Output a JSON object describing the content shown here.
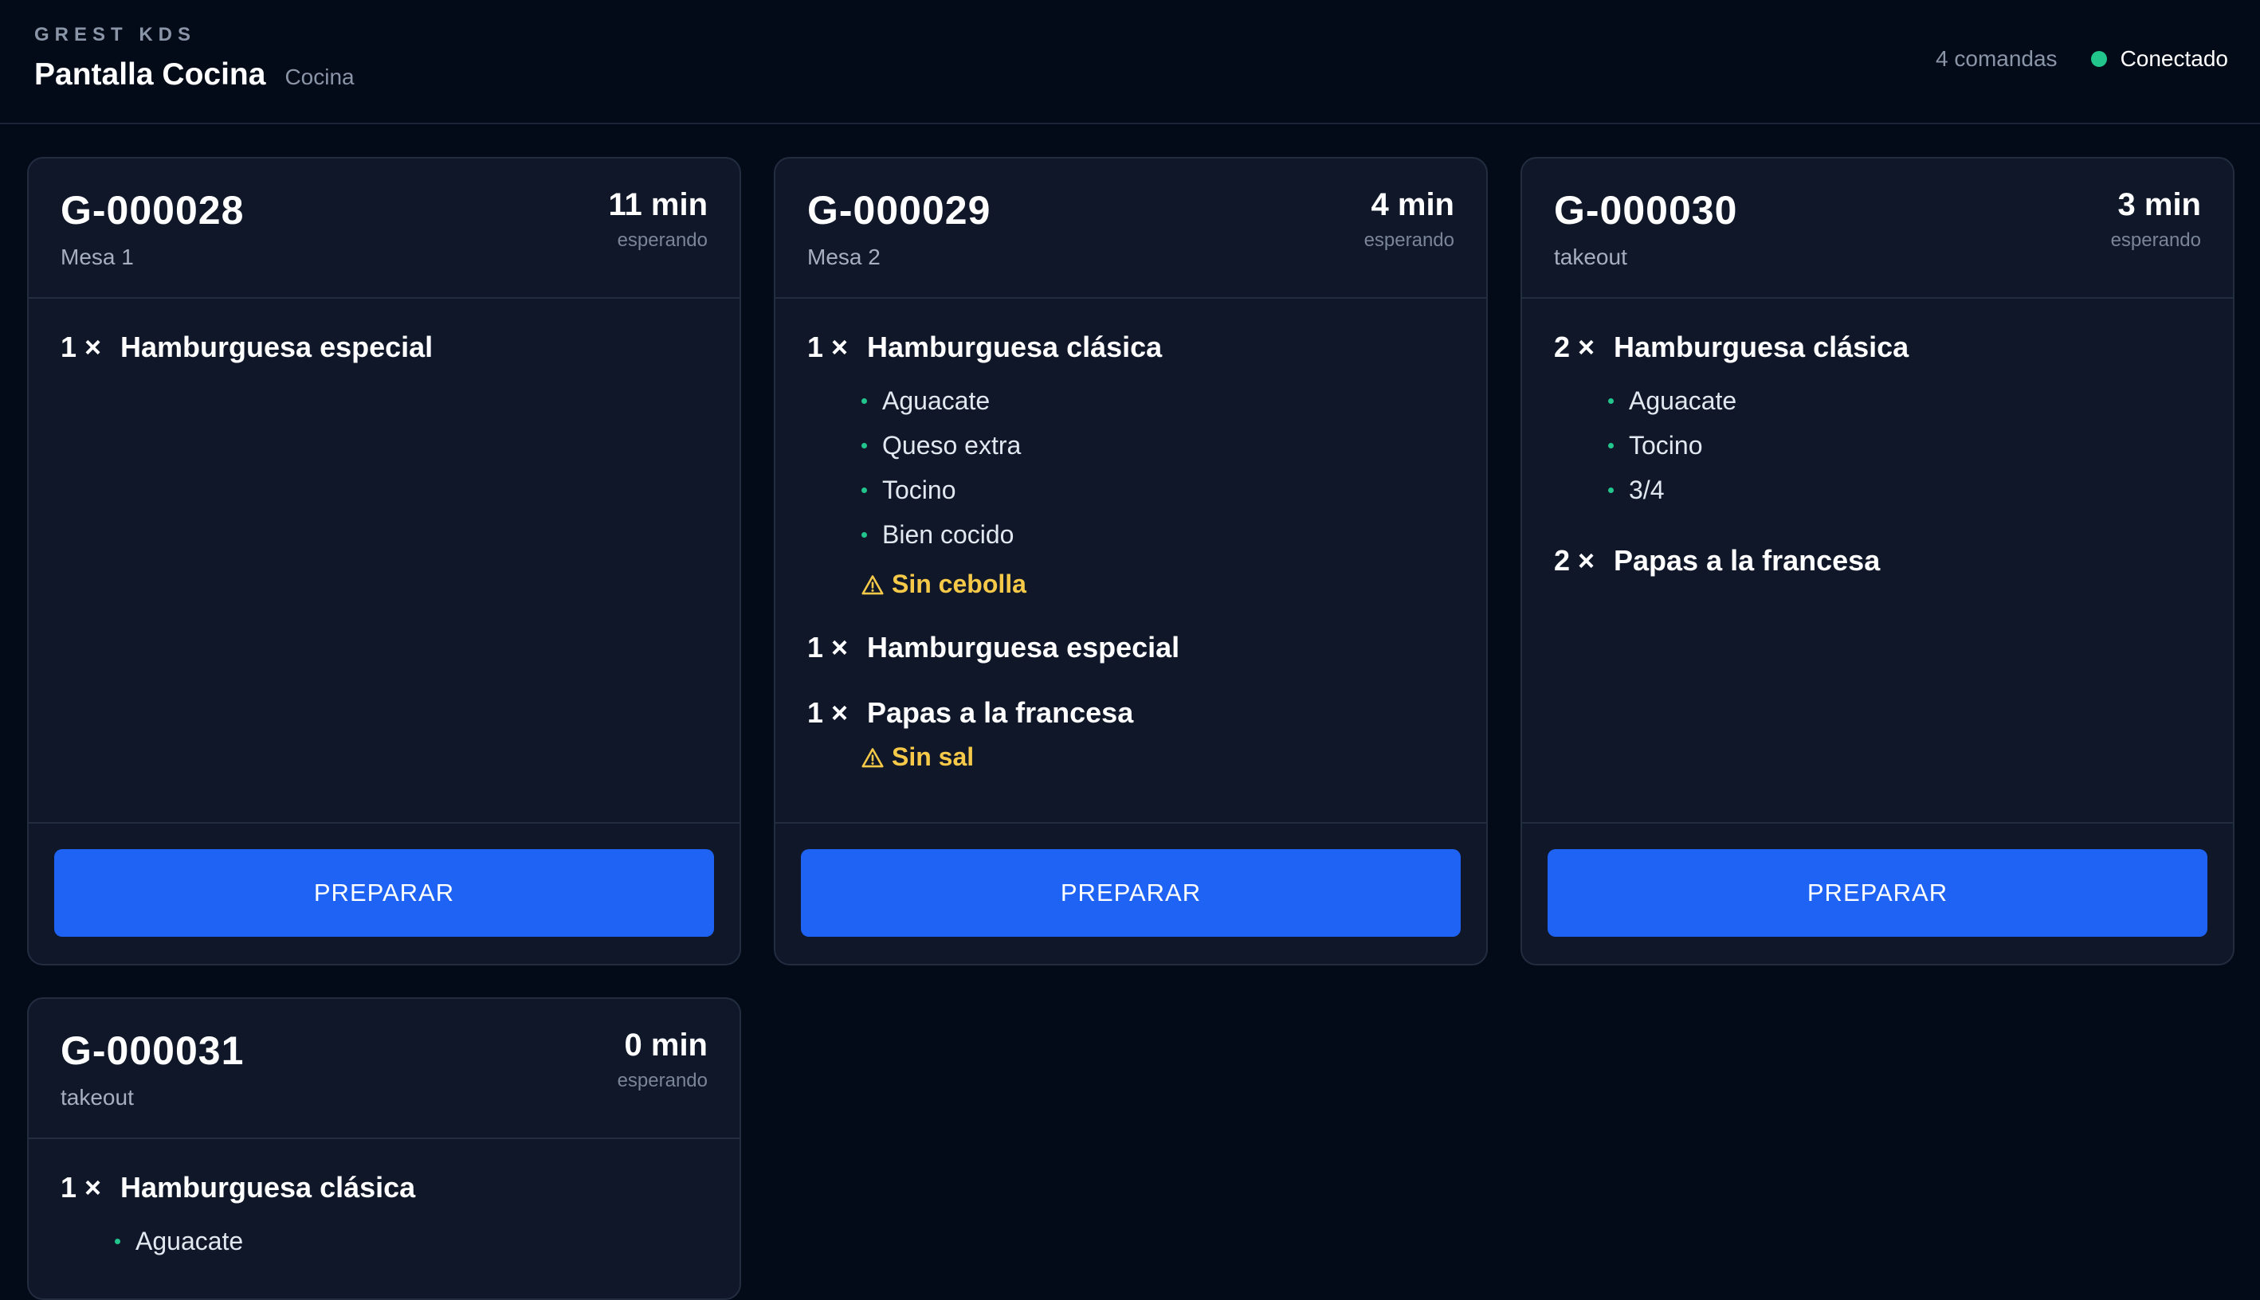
{
  "header": {
    "brand": "GREST KDS",
    "title": "Pantalla Cocina",
    "station": "Cocina",
    "orders_count": "4 comandas",
    "status": "Conectado",
    "status_color": "#22c58b"
  },
  "colors": {
    "background": "#030a18",
    "card": "#0f1729",
    "accent": "#1f63f5",
    "warning": "#f7c948"
  },
  "orders": [
    {
      "id": "G-000028",
      "location": "Mesa 1",
      "wait": "11 min",
      "wait_label": "esperando",
      "button": "PREPARAR",
      "items": [
        {
          "qty": "1 ×",
          "name": "Hamburguesa especial",
          "mods": [],
          "note": ""
        }
      ]
    },
    {
      "id": "G-000029",
      "location": "Mesa 2",
      "wait": "4 min",
      "wait_label": "esperando",
      "button": "PREPARAR",
      "items": [
        {
          "qty": "1 ×",
          "name": "Hamburguesa clásica",
          "mods": [
            "Aguacate",
            "Queso extra",
            "Tocino",
            "Bien cocido"
          ],
          "note": "Sin cebolla"
        },
        {
          "qty": "1 ×",
          "name": "Hamburguesa especial",
          "mods": [],
          "note": ""
        },
        {
          "qty": "1 ×",
          "name": "Papas a la francesa",
          "mods": [],
          "note": "Sin sal"
        }
      ]
    },
    {
      "id": "G-000030",
      "location": "takeout",
      "wait": "3 min",
      "wait_label": "esperando",
      "button": "PREPARAR",
      "items": [
        {
          "qty": "2 ×",
          "name": "Hamburguesa clásica",
          "mods": [
            "Aguacate",
            "Tocino",
            "3/4"
          ],
          "note": ""
        },
        {
          "qty": "2 ×",
          "name": "Papas a la francesa",
          "mods": [],
          "note": ""
        }
      ]
    },
    {
      "id": "G-000031",
      "location": "takeout",
      "wait": "0 min",
      "wait_label": "esperando",
      "button": "",
      "items": [
        {
          "qty": "1 ×",
          "name": "Hamburguesa clásica",
          "mods": [
            "Aguacate"
          ],
          "note": ""
        }
      ]
    }
  ]
}
